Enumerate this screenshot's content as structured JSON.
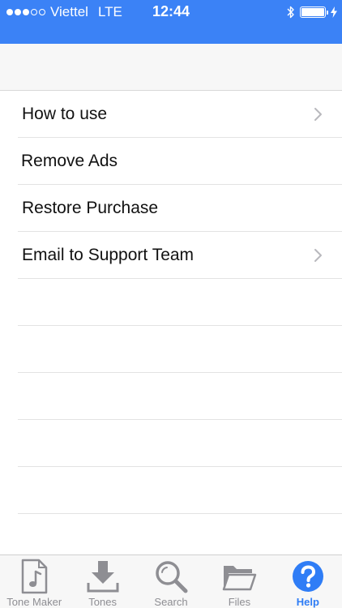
{
  "status": {
    "carrier": "Viettel",
    "network": "LTE",
    "time": "12:44"
  },
  "list": {
    "items": [
      {
        "label": "How to use",
        "chevron": true
      },
      {
        "label": "Remove Ads",
        "chevron": false
      },
      {
        "label": "Restore Purchase",
        "chevron": false
      },
      {
        "label": "Email to Support Team",
        "chevron": true
      }
    ]
  },
  "tabs": [
    {
      "label": "Tone Maker",
      "icon": "music-file-icon",
      "active": false
    },
    {
      "label": "Tones",
      "icon": "download-icon",
      "active": false
    },
    {
      "label": "Search",
      "icon": "search-icon",
      "active": false
    },
    {
      "label": "Files",
      "icon": "folder-icon",
      "active": false
    },
    {
      "label": "Help",
      "icon": "help-icon",
      "active": true
    }
  ],
  "colors": {
    "accent": "#2f7df6",
    "status_bar": "#3b82f6",
    "inactive": "#8e8e93"
  }
}
